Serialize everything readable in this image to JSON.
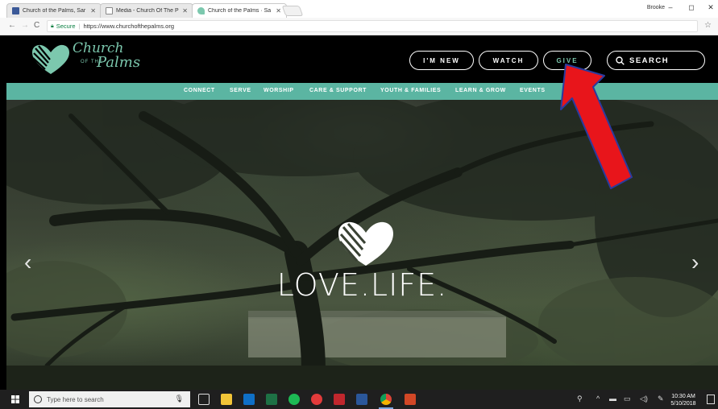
{
  "browser": {
    "tabs": [
      {
        "title": "Church of the Palms, Sar",
        "favicon_color": "#3b5998"
      },
      {
        "title": "Media - Church Of The P",
        "favicon_color": "#ffffff"
      },
      {
        "title": "Church of the Palms · Sa",
        "favicon_color": "#7cc8ae"
      }
    ],
    "user_name": "Brooke",
    "window_controls": {
      "minimize": "–",
      "maximize": "◻",
      "close": "✕"
    },
    "secure_label": "Secure",
    "url": "https://www.churchofthepalms.org",
    "icons": [
      "back-icon",
      "forward-icon",
      "reload-icon",
      "lock-icon",
      "star-icon"
    ]
  },
  "site": {
    "logo": {
      "line1": "Church",
      "of_the": "OF THE",
      "line2": "Palms"
    },
    "header_buttons": [
      "I'M NEW",
      "WATCH",
      "GIVE"
    ],
    "search_label": "SEARCH",
    "nav": [
      "CONNECT",
      "SERVE",
      "WORSHIP",
      "CARE & SUPPORT",
      "YOUTH & FAMILIES",
      "LEARN & GROW",
      "EVENTS"
    ],
    "hero_title": "LOVE.LIFE.",
    "carousel": {
      "prev": "‹",
      "next": "›"
    },
    "colors": {
      "accent": "#5bb5a2",
      "logo": "#7cc8ae",
      "header_bg": "#000000"
    }
  },
  "annotation": {
    "type": "arrow",
    "color": "#e8151b",
    "points_to": "GIVE"
  },
  "taskbar": {
    "search_placeholder": "Type here to search",
    "apps": [
      "task-view-icon",
      "file-explorer-icon",
      "outlook-icon",
      "excel-icon",
      "spotify-icon",
      "app-icon",
      "acrobat-icon",
      "word-icon",
      "chrome-icon",
      "powerpoint-icon"
    ],
    "time": "10:30 AM",
    "date": "5/10/2018"
  }
}
